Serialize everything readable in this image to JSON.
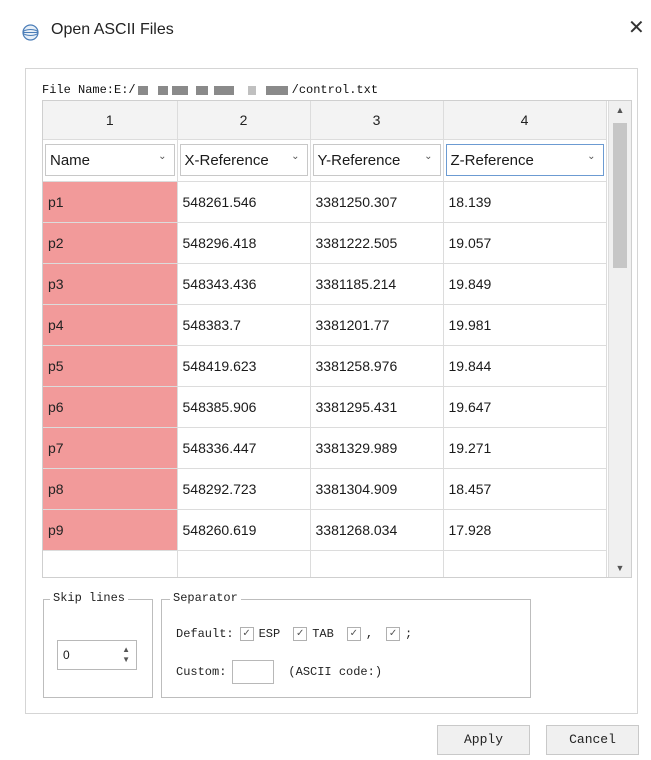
{
  "window": {
    "title": "Open ASCII Files",
    "close_glyph": "✕",
    "icon": "globe-disk-icon"
  },
  "file": {
    "label": "File Name:E:/",
    "suffix": "/control.txt"
  },
  "table": {
    "column_numbers": [
      "1",
      "2",
      "3",
      "4"
    ],
    "column_headers": [
      "Name",
      "X-Reference",
      "Y-Reference",
      "Z-Reference"
    ],
    "rows": [
      [
        "p1",
        "548261.546",
        "3381250.307",
        "18.139"
      ],
      [
        "p2",
        "548296.418",
        "3381222.505",
        "19.057"
      ],
      [
        "p3",
        "548343.436",
        "3381185.214",
        "19.849"
      ],
      [
        "p4",
        "548383.7",
        "3381201.77",
        "19.981"
      ],
      [
        "p5",
        "548419.623",
        "3381258.976",
        "19.844"
      ],
      [
        "p6",
        "548385.906",
        "3381295.431",
        "19.647"
      ],
      [
        "p7",
        "548336.447",
        "3381329.989",
        "19.271"
      ],
      [
        "p8",
        "548292.723",
        "3381304.909",
        "18.457"
      ],
      [
        "p9",
        "548260.619",
        "3381268.034",
        "17.928"
      ]
    ],
    "name_highlight_color": "#f29a9a"
  },
  "skip_lines": {
    "title": "Skip lines",
    "value": "0"
  },
  "separator": {
    "title": "Separator",
    "default_label": "Default:",
    "options": [
      {
        "label": "ESP",
        "checked": true
      },
      {
        "label": "TAB",
        "checked": true
      },
      {
        "label": ",",
        "checked": true
      },
      {
        "label": ";",
        "checked": true
      }
    ],
    "custom_label": "Custom:",
    "custom_value": "",
    "custom_hint": "(ASCII code:)"
  },
  "buttons": {
    "apply": "Apply",
    "cancel": "Cancel"
  }
}
